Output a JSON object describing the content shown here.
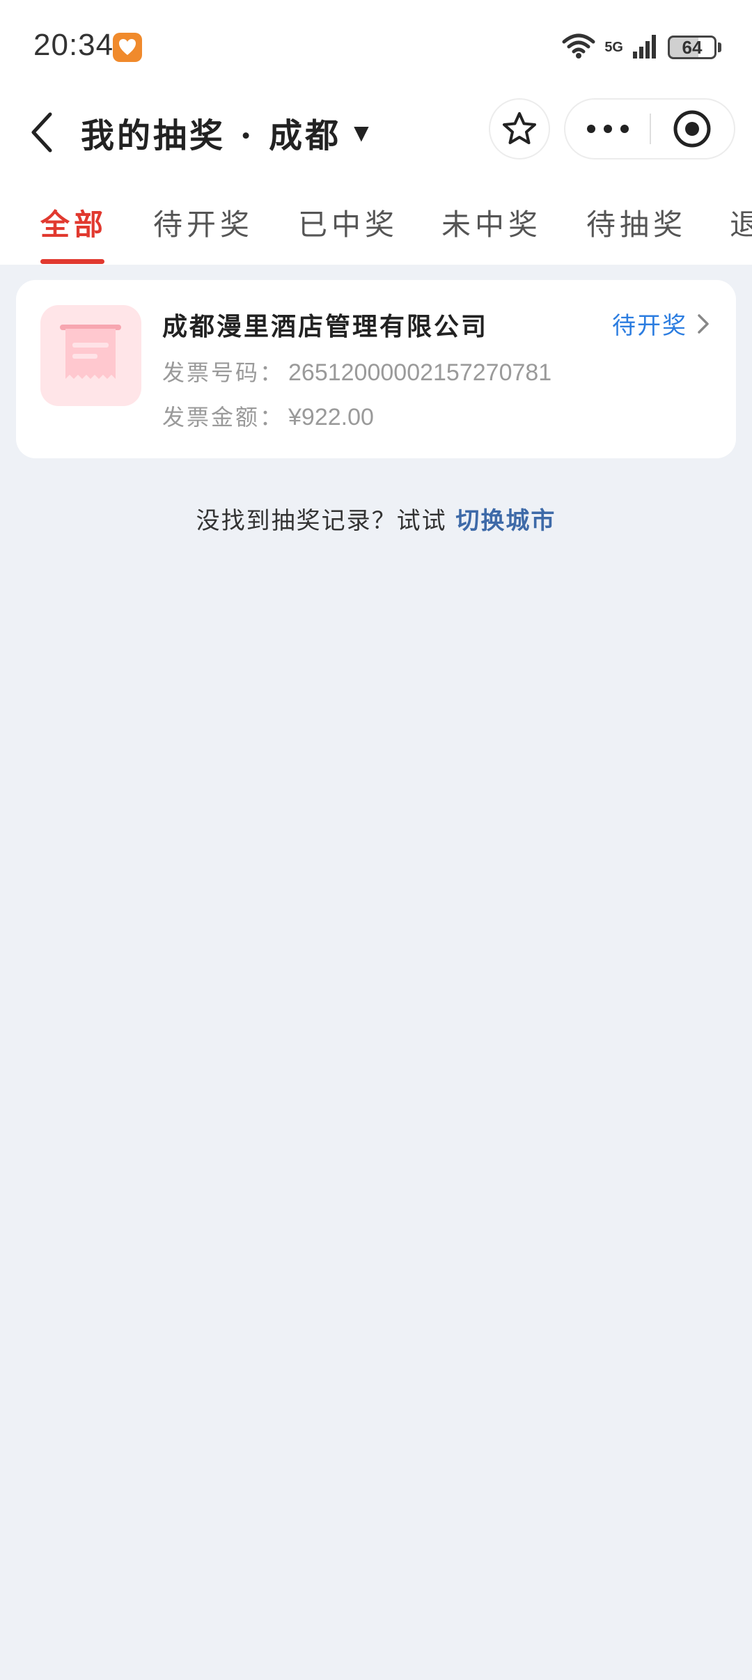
{
  "status_bar": {
    "time": "20:34",
    "network": "5G",
    "battery": "64",
    "icons": [
      "wifi-icon",
      "signal-icon",
      "battery-icon"
    ]
  },
  "nav": {
    "title": "我的抽奖 · 成都",
    "dropdown_glyph": "▼",
    "icons": [
      "back-icon",
      "star-icon",
      "more-icon",
      "target-icon"
    ]
  },
  "tabs": [
    {
      "label": "全部",
      "active": true
    },
    {
      "label": "待开奖",
      "active": false
    },
    {
      "label": "已中奖",
      "active": false
    },
    {
      "label": "未中奖",
      "active": false
    },
    {
      "label": "待抽奖",
      "active": false
    },
    {
      "label": "退",
      "active": false
    }
  ],
  "card": {
    "company": "成都漫里酒店管理有限公司",
    "status": "待开奖",
    "invoice_label": "发票号码：",
    "invoice_number": "26512000002157270781",
    "amount_label": "发票金额：",
    "amount": "¥922.00",
    "icon": "receipt-icon"
  },
  "hint": {
    "text": "没找到抽奖记录？试试",
    "link": "切换城市"
  },
  "colors": {
    "accent_red": "#e1392f",
    "status_blue": "#2c7de0",
    "link_blue": "#3e6aa8",
    "background": "#eef1f6"
  }
}
